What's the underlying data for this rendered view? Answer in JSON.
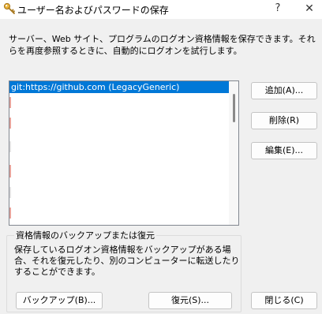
{
  "window": {
    "title": "ユーザー名およびパスワードの保存",
    "help_glyph": "?",
    "close_glyph": "✕"
  },
  "description": "サーバー、Web サイト、プログラムのログオン資格情報を保存できます。それらを再度参照するときに、自動的にログオンを試行します。",
  "credentials": {
    "items": [
      {
        "label": "git:https://github.com (LegacyGeneric)",
        "selected": true
      }
    ]
  },
  "buttons": {
    "add": "追加(A)...",
    "remove": "削除(R)",
    "edit": "編集(E)...",
    "close": "閉じる(C)"
  },
  "backup": {
    "legend": "資格情報のバックアップまたは復元",
    "text": "保存しているログオン資格情報をバックアップがある場合、それを復元したり、別のコンピューターに転送したりすることができます。",
    "backup_button": "バックアップ(B)...",
    "restore_button": "復元(S)..."
  },
  "colors": {
    "selection": "#0078d7",
    "window_bg": "#f0f0f0",
    "list_border": "#828790"
  },
  "icons": {
    "title_icon": "key-icon"
  }
}
